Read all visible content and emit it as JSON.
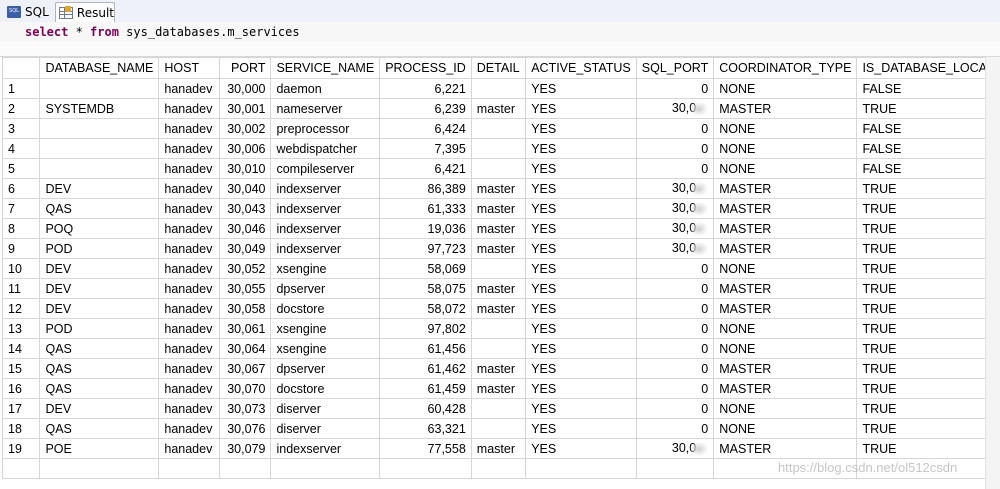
{
  "tabs": [
    {
      "label": "SQL",
      "icon": "sql-file-icon",
      "active": false
    },
    {
      "label": "Result",
      "icon": "result-grid-icon",
      "active": true
    }
  ],
  "query": {
    "kw1": "select",
    "star": " * ",
    "kw2": "from",
    "rest": " sys_databases.m_services"
  },
  "result": {
    "columns": [
      "",
      "DATABASE_NAME",
      "HOST",
      "PORT",
      "SERVICE_NAME",
      "PROCESS_ID",
      "DETAIL",
      "ACTIVE_STATUS",
      "SQL_PORT",
      "COORDINATOR_TYPE",
      "IS_DATABASE_LOCAL"
    ],
    "rows": [
      [
        "1",
        "",
        "hanadev",
        "30,000",
        "daemon",
        "6,221",
        "",
        "YES",
        "0",
        "NONE",
        "FALSE"
      ],
      [
        "2",
        "SYSTEMDB",
        "hanadev",
        "30,001",
        "nameserver",
        "6,239",
        "master",
        "YES",
        "30,0",
        "MASTER",
        "TRUE"
      ],
      [
        "3",
        "",
        "hanadev",
        "30,002",
        "preprocessor",
        "6,424",
        "",
        "YES",
        "0",
        "NONE",
        "FALSE"
      ],
      [
        "4",
        "",
        "hanadev",
        "30,006",
        "webdispatcher",
        "7,395",
        "",
        "YES",
        "0",
        "NONE",
        "FALSE"
      ],
      [
        "5",
        "",
        "hanadev",
        "30,010",
        "compileserver",
        "6,421",
        "",
        "YES",
        "0",
        "NONE",
        "FALSE"
      ],
      [
        "6",
        "DEV",
        "hanadev",
        "30,040",
        "indexserver",
        "86,389",
        "master",
        "YES",
        "30,0",
        "MASTER",
        "TRUE"
      ],
      [
        "7",
        "QAS",
        "hanadev",
        "30,043",
        "indexserver",
        "61,333",
        "master",
        "YES",
        "30,0",
        "MASTER",
        "TRUE"
      ],
      [
        "8",
        "POQ",
        "hanadev",
        "30,046",
        "indexserver",
        "19,036",
        "master",
        "YES",
        "30,0",
        "MASTER",
        "TRUE"
      ],
      [
        "9",
        "POD",
        "hanadev",
        "30,049",
        "indexserver",
        "97,723",
        "master",
        "YES",
        "30,0",
        "MASTER",
        "TRUE"
      ],
      [
        "10",
        "DEV",
        "hanadev",
        "30,052",
        "xsengine",
        "58,069",
        "",
        "YES",
        "0",
        "NONE",
        "TRUE"
      ],
      [
        "11",
        "DEV",
        "hanadev",
        "30,055",
        "dpserver",
        "58,075",
        "master",
        "YES",
        "0",
        "MASTER",
        "TRUE"
      ],
      [
        "12",
        "DEV",
        "hanadev",
        "30,058",
        "docstore",
        "58,072",
        "master",
        "YES",
        "0",
        "MASTER",
        "TRUE"
      ],
      [
        "13",
        "POD",
        "hanadev",
        "30,061",
        "xsengine",
        "97,802",
        "",
        "YES",
        "0",
        "NONE",
        "TRUE"
      ],
      [
        "14",
        "QAS",
        "hanadev",
        "30,064",
        "xsengine",
        "61,456",
        "",
        "YES",
        "0",
        "NONE",
        "TRUE"
      ],
      [
        "15",
        "QAS",
        "hanadev",
        "30,067",
        "dpserver",
        "61,462",
        "master",
        "YES",
        "0",
        "MASTER",
        "TRUE"
      ],
      [
        "16",
        "QAS",
        "hanadev",
        "30,070",
        "docstore",
        "61,459",
        "master",
        "YES",
        "0",
        "MASTER",
        "TRUE"
      ],
      [
        "17",
        "DEV",
        "hanadev",
        "30,073",
        "diserver",
        "60,428",
        "",
        "YES",
        "0",
        "NONE",
        "TRUE"
      ],
      [
        "18",
        "QAS",
        "hanadev",
        "30,076",
        "diserver",
        "63,321",
        "",
        "YES",
        "0",
        "NONE",
        "TRUE"
      ],
      [
        "19",
        "POE",
        "hanadev",
        "30,079",
        "indexserver",
        "77,558",
        "master",
        "YES",
        "30,0",
        "MASTER",
        "TRUE"
      ]
    ]
  },
  "watermark": "https://blog.csdn.net/ol512csdn",
  "colors": {
    "keyword": "#7f0055",
    "grid_border": "#d6d6d6",
    "tab_bar": "#eef1f7"
  }
}
